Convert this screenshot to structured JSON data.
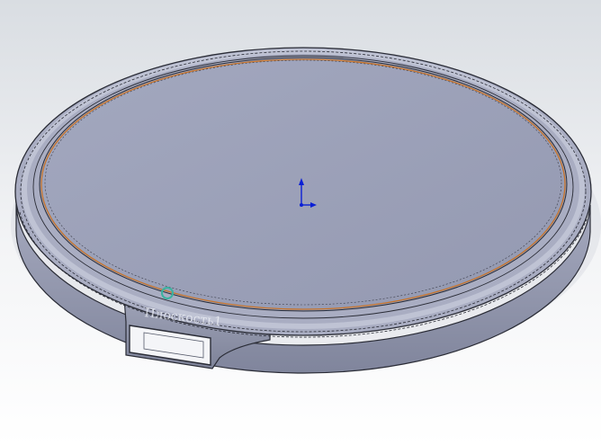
{
  "viewport": {
    "background_top": "#d9dde2",
    "background_bottom": "#ffffff"
  },
  "model": {
    "face_color": "#9aa0b8",
    "wall_color": "#8d92aa",
    "rim_highlight": "#c4c8d8",
    "edge_color": "#2a2c36",
    "inner_edge_color": "#c8742a",
    "hover_marker_color": "#3ab3a0",
    "neck_label": "Плоскость1"
  },
  "triad": {
    "color": "#0a1fd6",
    "icon": "origin-triad-icon"
  }
}
